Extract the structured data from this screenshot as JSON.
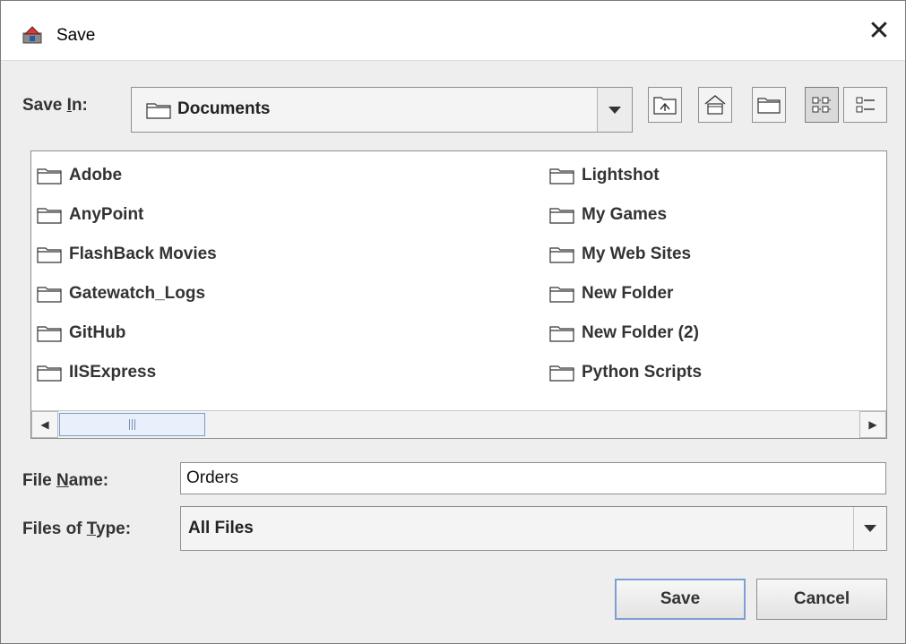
{
  "window": {
    "title": "Save",
    "close_glyph": "✕"
  },
  "save_in": {
    "label_prefix": "Save ",
    "label_mnemonic": "I",
    "label_suffix": "n:",
    "value": "Documents"
  },
  "toolbar": [
    {
      "name": "up-one-level-button",
      "icon": "up-folder-icon"
    },
    {
      "name": "home-button",
      "icon": "home-icon"
    },
    {
      "name": "new-folder-button",
      "icon": "new-folder-icon"
    },
    {
      "name": "list-view-button",
      "icon": "list-view-icon",
      "active": true
    },
    {
      "name": "details-view-button",
      "icon": "details-view-icon",
      "active": false
    }
  ],
  "files": {
    "column1": [
      "Adobe",
      "AnyPoint",
      "FlashBack Movies",
      "Gatewatch_Logs",
      "GitHub",
      "IISExpress"
    ],
    "column2": [
      "Lightshot",
      "My Games",
      "My Web Sites",
      "New Folder",
      "New Folder (2)",
      "Python Scripts"
    ]
  },
  "scrollbar": {
    "left_arrow": "◀",
    "right_arrow": "▶"
  },
  "file_name": {
    "label_prefix": "File ",
    "label_mnemonic": "N",
    "label_suffix": "ame:",
    "value": "Orders"
  },
  "file_type": {
    "label_prefix": "Files of ",
    "label_mnemonic": "T",
    "label_suffix": "ype:",
    "value": "All Files"
  },
  "buttons": {
    "save": "Save",
    "cancel": "Cancel"
  },
  "colors": {
    "accent": "#7f9ed6",
    "background": "#eeeeee"
  }
}
